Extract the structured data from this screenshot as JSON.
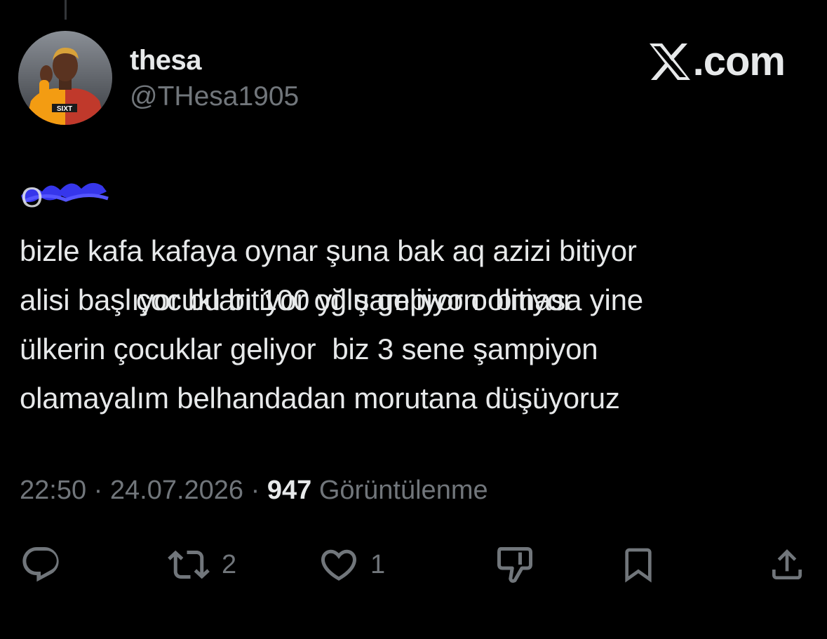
{
  "author": {
    "display_name": "thesa",
    "handle": "@THesa1905",
    "avatar_icon": "profile-photo-footballer"
  },
  "brand": {
    "icon": "x-logo-icon",
    "text": ".com"
  },
  "tweet": {
    "lines": [
      "çocukları 100 yıl şampiyon olmasa yine",
      "bizle kafa kafaya oynar şuna bak aq azizi bitiyor",
      "alisi başlıyor bu bitiyor oğlu geliyor o bitiyor",
      "ülkerin çocuklar geliyor  biz 3 sene şampiyon",
      "olamayalım belhandadan morutana düşüyoruz"
    ],
    "redacted_first_word_note": "scribble"
  },
  "meta": {
    "time": "22:50",
    "separator": " · ",
    "date": "24.07.2026",
    "views_count": "947",
    "views_label": "Görüntülenme"
  },
  "actions": {
    "reply": {
      "icon": "reply-icon",
      "count": ""
    },
    "repost": {
      "icon": "repost-icon",
      "count": "2"
    },
    "like": {
      "icon": "heart-icon",
      "count": "1"
    },
    "dislike": {
      "icon": "dislike-icon",
      "count": ""
    },
    "bookmark": {
      "icon": "bookmark-icon",
      "count": ""
    },
    "share": {
      "icon": "share-icon",
      "count": ""
    }
  },
  "colors": {
    "background": "#000000",
    "primary_text": "#e7e9ea",
    "secondary_text": "#71767b",
    "redaction_scribble": "#3b3bff"
  }
}
